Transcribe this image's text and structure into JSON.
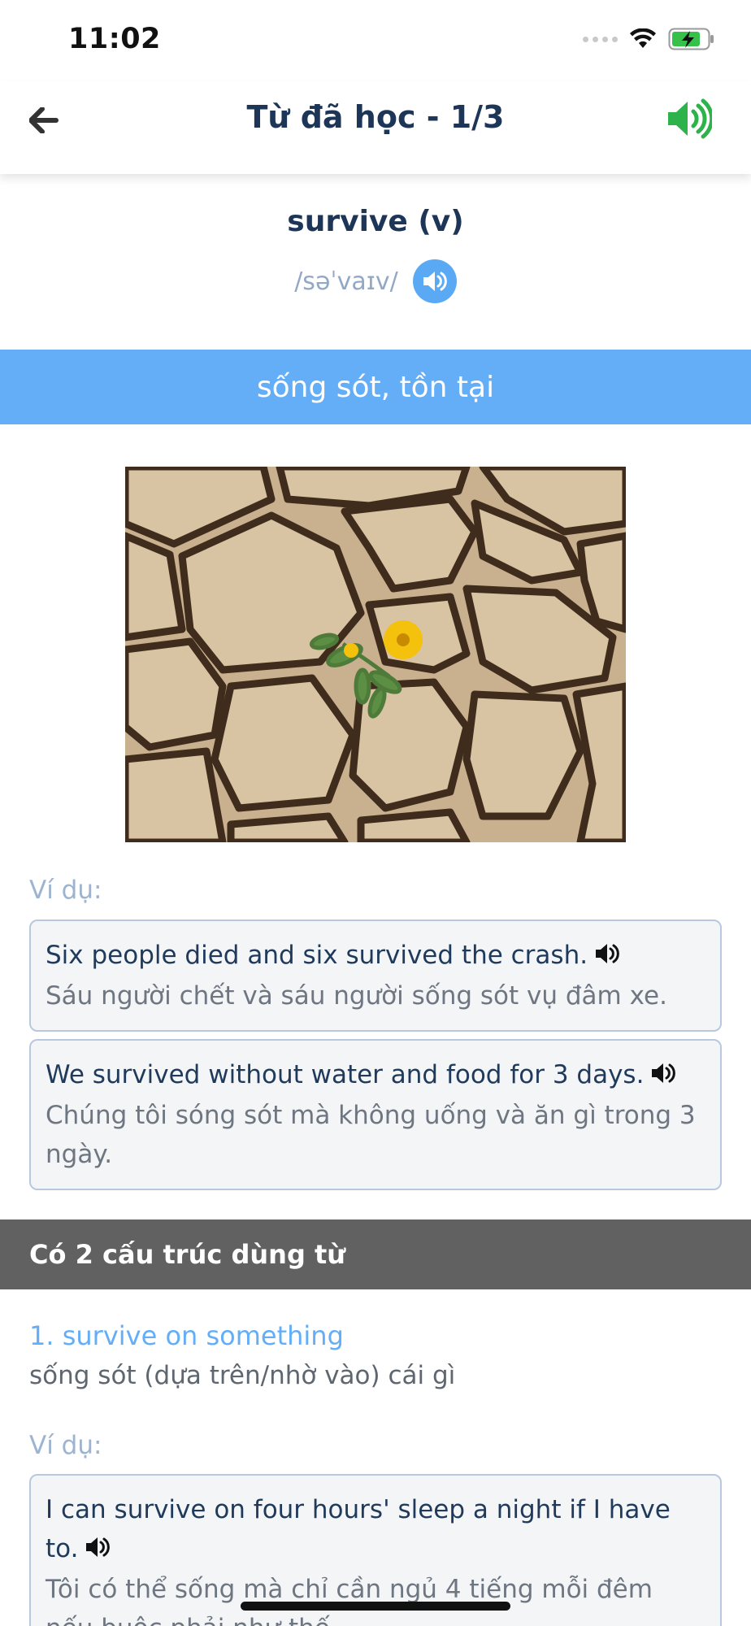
{
  "status_bar": {
    "time": "11:02"
  },
  "nav": {
    "title": "Từ đã học - 1/3",
    "back_icon": "arrow-left-icon",
    "speaker_icon": "speaker-volume-icon",
    "speaker_color": "#2db34a"
  },
  "word": {
    "title": "survive (v)",
    "phonetic": "/səˈvaɪv/",
    "audio_icon": "speaker-icon"
  },
  "meaning": "sống sót, tồn tại",
  "examples_label": "Ví dụ:",
  "examples": [
    {
      "en": "Six people died and six survived the crash.",
      "vi": "Sáu người chết và sáu người sống sót vụ đâm xe."
    },
    {
      "en": "We survived without water and food for 3 days.",
      "vi": "Chúng tôi sóng sót mà không uống và ăn gì trong 3 ngày."
    }
  ],
  "structures_header": "Có 2 cấu trúc dùng từ",
  "structures": [
    {
      "name": "1. survive on something",
      "meaning": "sống sót (dựa trên/nhờ vào) cái gì",
      "examples_label": "Ví dụ:",
      "examples": [
        {
          "en": "I can survive on four hours' sleep a night if I have to.",
          "vi": "Tôi có thể sống mà chỉ cần ngủ 4 tiếng mỗi đêm nếu buộc phải như thế."
        }
      ]
    }
  ],
  "colors": {
    "accent_blue": "#63aef7",
    "title_navy": "#1d3557",
    "header_gray": "#616161"
  }
}
